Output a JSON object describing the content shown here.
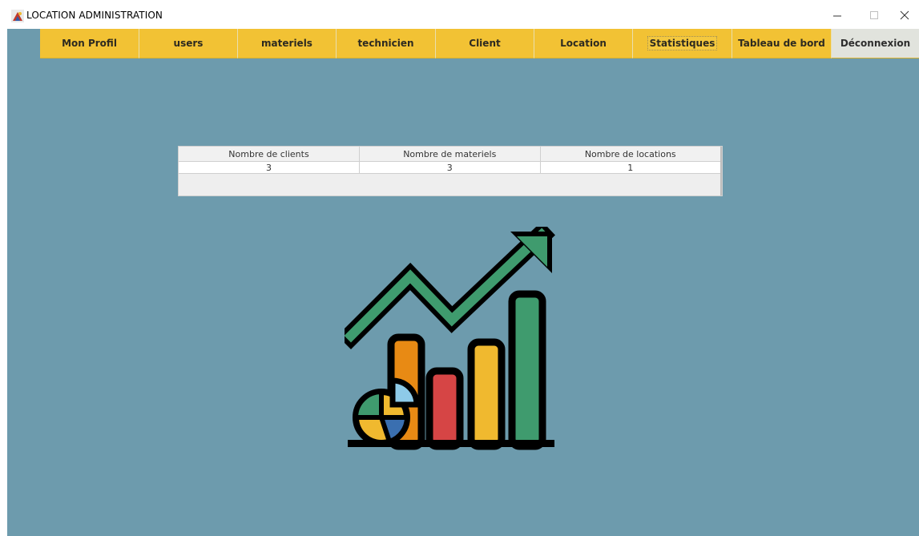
{
  "window": {
    "title": "LOCATION ADMINISTRATION",
    "controls": {
      "minimize": "—",
      "maximize": "☐",
      "close": "✕"
    }
  },
  "nav": {
    "items": [
      {
        "label": "Mon Profil"
      },
      {
        "label": "users"
      },
      {
        "label": "materiels"
      },
      {
        "label": "technicien"
      },
      {
        "label": "Client"
      },
      {
        "label": "Location"
      },
      {
        "label": "Statistiques"
      },
      {
        "label": "Tableau de bord"
      },
      {
        "label": "Déconnexion"
      }
    ]
  },
  "stats_table": {
    "headers": [
      "Nombre de clients",
      "Nombre de materiels",
      "Nombre de locations"
    ],
    "rows": [
      [
        "3",
        "3",
        "1"
      ]
    ]
  },
  "illustration": {
    "icon": "growth-chart-icon"
  },
  "colors": {
    "background": "#6d9bad",
    "nav_button": "#f2c234",
    "logout_button": "#e1e3dd",
    "arrow": "#3f9b6e",
    "bar_orange": "#e88a14",
    "bar_red": "#d64545",
    "bar_yellow": "#f0b92f",
    "bar_green": "#3f9b6e"
  }
}
